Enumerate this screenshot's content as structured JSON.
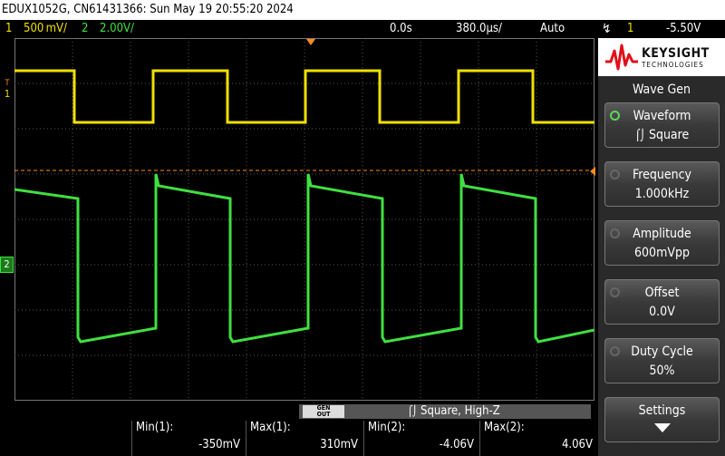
{
  "title_bar": {
    "text": "EDUX1052G, CN61431366: Sun May 19 20:55:20 2024"
  },
  "status": {
    "ch1_num": "1",
    "ch1_scale": "500 mV/",
    "ch2_num": "2",
    "ch2_scale": "2.00V/",
    "time_delay": "0.0s",
    "time_scale": "380.0µs/",
    "trigger_mode": "Auto",
    "trigger_source": "1",
    "trigger_level": "-5.50V"
  },
  "markers": {
    "ch1": "1",
    "ch1_t": "T",
    "ch2": "2"
  },
  "brand": {
    "name": "KEYSIGHT",
    "sub": "TECHNOLOGIES"
  },
  "menu": {
    "title": "Wave Gen",
    "keys": [
      {
        "label": "Waveform",
        "value": "Square"
      },
      {
        "label": "Frequency",
        "value": "1.000kHz"
      },
      {
        "label": "Amplitude",
        "value": "600mVpp"
      },
      {
        "label": "Offset",
        "value": "0.0V"
      },
      {
        "label": "Duty Cycle",
        "value": "50%"
      },
      {
        "label": "Settings",
        "value": ""
      }
    ]
  },
  "gen_bar": {
    "button_line1": "GEN",
    "button_line2": "OUT",
    "text": "Square, High-Z"
  },
  "measurements": [
    {
      "label": "Min(1):",
      "value": "-350mV"
    },
    {
      "label": "Max(1):",
      "value": "310mV"
    },
    {
      "label": "Min(2):",
      "value": "-4.06V"
    },
    {
      "label": "Max(2):",
      "value": "4.06V"
    }
  ],
  "colors": {
    "ch1": "#f0e000",
    "ch2": "#40e040",
    "trigger": "#ff8c1a",
    "grid": "#555555"
  }
}
